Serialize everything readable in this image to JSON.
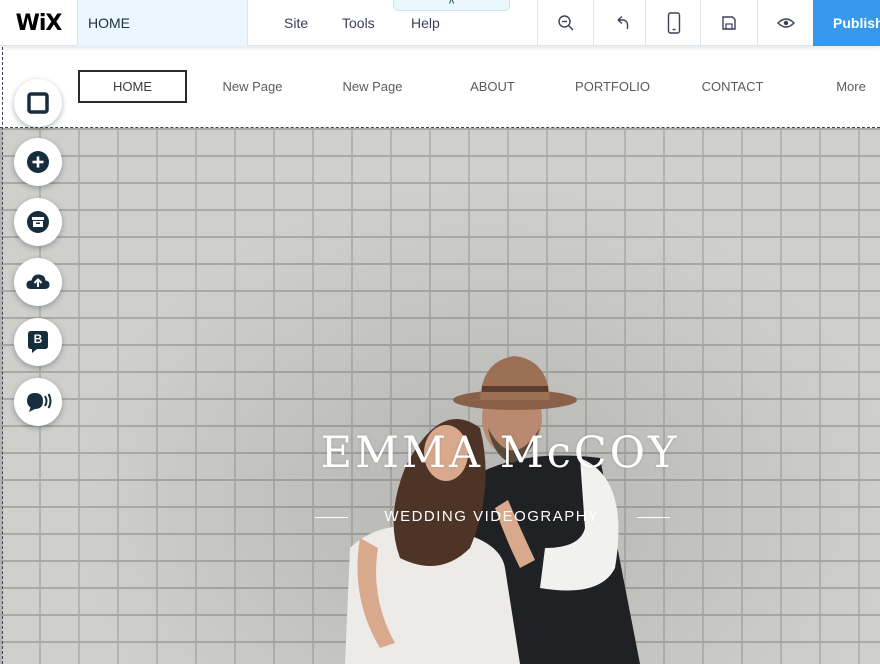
{
  "editor": {
    "logo": "WiX",
    "current_page": "HOME",
    "menu": [
      "Site",
      "Tools",
      "Help"
    ],
    "collapse_glyph": "^",
    "tools": [
      {
        "name": "zoom-out-icon"
      },
      {
        "name": "undo-icon"
      },
      {
        "name": "mobile-view-icon"
      },
      {
        "name": "save-icon"
      },
      {
        "name": "preview-icon"
      }
    ],
    "publish_label": "Publish",
    "accent_color": "#3899ec"
  },
  "left_rail": [
    {
      "name": "background-icon"
    },
    {
      "name": "add-icon"
    },
    {
      "name": "app-market-icon"
    },
    {
      "name": "upload-icon"
    },
    {
      "name": "blog-icon"
    },
    {
      "name": "chat-icon",
      "label": "B"
    }
  ],
  "site": {
    "nav": [
      "HOME",
      "New Page",
      "New Page",
      "ABOUT",
      "PORTFOLIO",
      "CONTACT",
      "More"
    ],
    "hero": {
      "title": "EMMA McCOY",
      "subtitle": "WEDDING VIDEOGRAPHY"
    }
  }
}
